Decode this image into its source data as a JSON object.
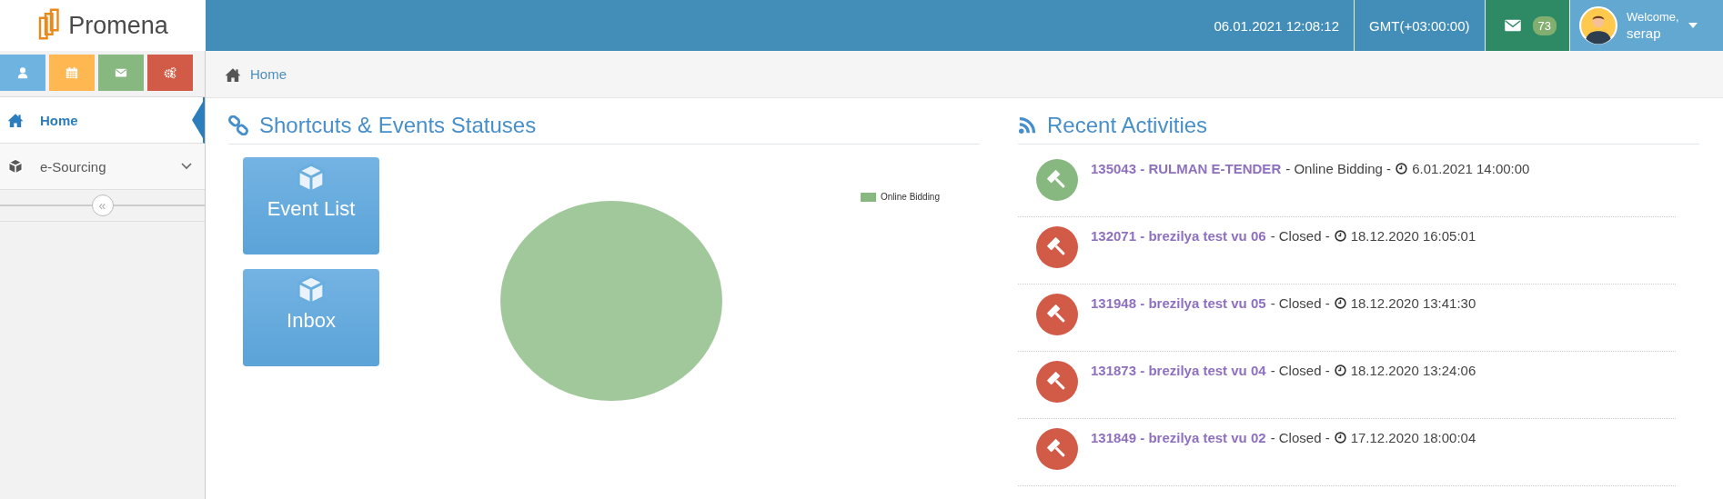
{
  "brand": {
    "name": "Promena"
  },
  "top_bar": {
    "datetime": "06.01.2021 12:08:12",
    "timezone": "GMT(+03:00:00)",
    "messages": {
      "count": "73"
    },
    "user": {
      "greeting": "Welcome,",
      "name": "serap"
    }
  },
  "shortcut_buttons": [
    {
      "kind": "user",
      "color": "#6fb3e0"
    },
    {
      "kind": "calendar",
      "color": "#ffb752"
    },
    {
      "kind": "mail",
      "color": "#87b87f"
    },
    {
      "kind": "settings",
      "color": "#d15b47"
    }
  ],
  "sidebar": {
    "items": [
      {
        "label": "Home",
        "kind": "home",
        "selected": true
      },
      {
        "label": "e-Sourcing",
        "kind": "cube",
        "selected": false,
        "expanded": false
      }
    ],
    "collapse_button": "«"
  },
  "breadcrumb": {
    "items": [
      "Home"
    ]
  },
  "shortcuts": {
    "title": "Shortcuts & Events Statuses",
    "tiles": [
      "Event List",
      "Inbox"
    ],
    "chart": {
      "legend": [
        {
          "label": "Online Bidding",
          "color": "#87b87f"
        }
      ]
    }
  },
  "recent_activities": {
    "title": "Recent Activities",
    "items": [
      {
        "title": "135043 - RULMAN E-TENDER",
        "detail": "- Online Bidding -",
        "date": "6.01.2021 14:00:00",
        "color": "#87b87f"
      },
      {
        "title": "132071 - brezilya test vu 06",
        "detail": "- Closed -",
        "date": "18.12.2020 16:05:01",
        "color": "#d15b47"
      },
      {
        "title": "131948 - brezilya test vu 05",
        "detail": "- Closed -",
        "date": "18.12.2020 13:41:30",
        "color": "#d15b47"
      },
      {
        "title": "131873 - brezilya test vu 04",
        "detail": "- Closed -",
        "date": "18.12.2020 13:24:06",
        "color": "#d15b47"
      },
      {
        "title": "131849 - brezilya test vu 02",
        "detail": "- Closed -",
        "date": "17.12.2020 18:00:04",
        "color": "#d15b47"
      }
    ]
  }
}
